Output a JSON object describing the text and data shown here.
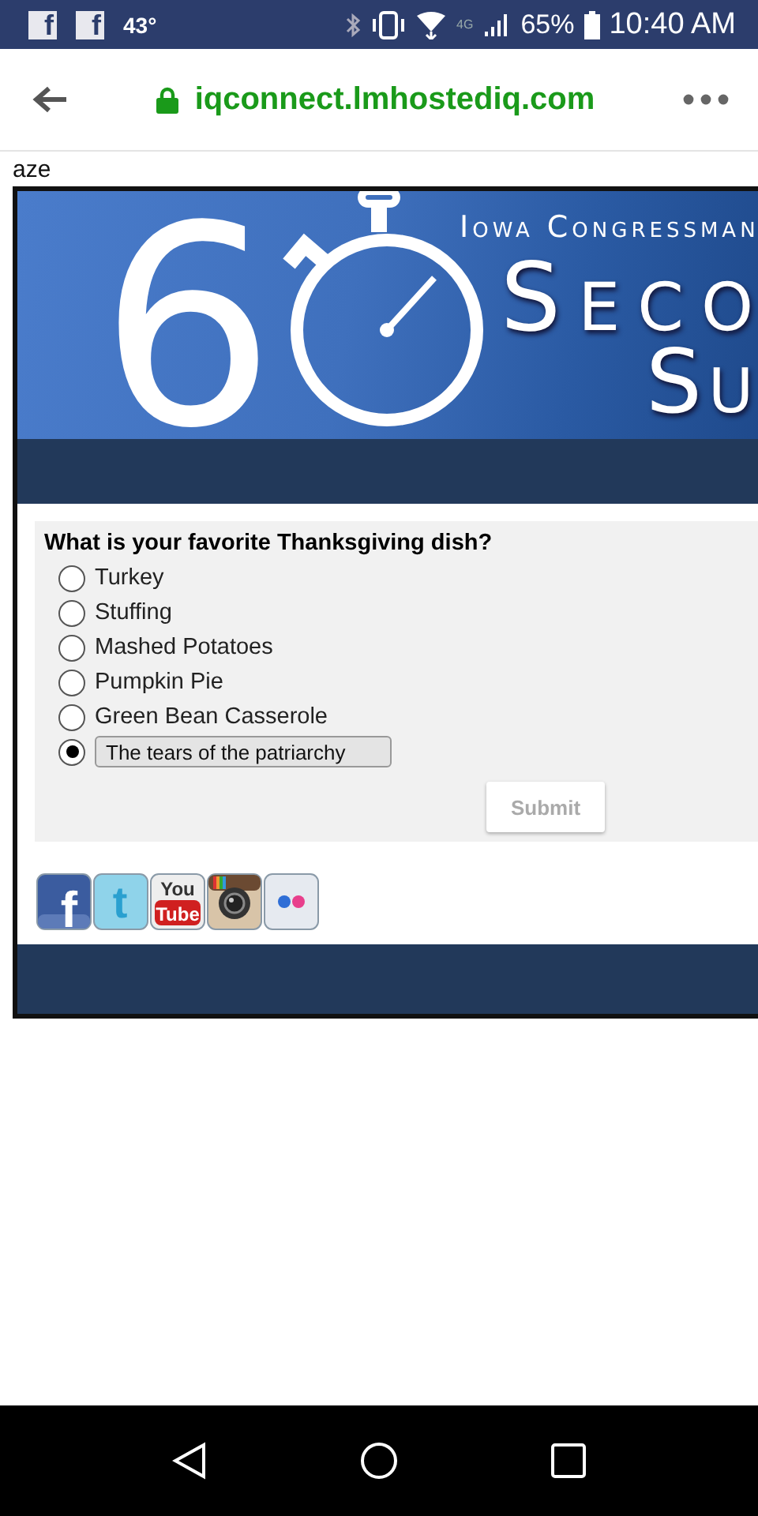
{
  "status_bar": {
    "notifications": [
      {
        "kind": "facebook",
        "glyph": "f"
      },
      {
        "kind": "facebook",
        "glyph": "f"
      }
    ],
    "temperature": "43°",
    "network": "4G",
    "battery": "65%",
    "time": "10:40 AM"
  },
  "browser_bar": {
    "url": "iqconnect.lmhostediq.com",
    "secure": true
  },
  "page_text": "aze",
  "banner": {
    "numeral": "6",
    "subtitle": "Iowa Congressman",
    "title_line_1": "Seco",
    "title_line_2": "Su"
  },
  "poll": {
    "question": "What is your favorite Thanksgiving dish?",
    "options": [
      {
        "kind": "choice",
        "label": "Turkey",
        "selected": false
      },
      {
        "kind": "choice",
        "label": "Stuffing",
        "selected": false
      },
      {
        "kind": "choice",
        "label": "Mashed Potatoes",
        "selected": false
      },
      {
        "kind": "choice",
        "label": "Pumpkin Pie",
        "selected": false
      },
      {
        "kind": "choice",
        "label": "Green Bean Casserole",
        "selected": false
      },
      {
        "kind": "other",
        "value": "The tears of the patriarchy",
        "selected": true
      }
    ],
    "submit": "Submit"
  },
  "social_icons": [
    {
      "kind": "facebook",
      "glyph": "f"
    },
    {
      "kind": "twitter",
      "glyph": "t"
    },
    {
      "kind": "youtube",
      "top": "You",
      "bottom": "Tube"
    },
    {
      "kind": "instagram"
    },
    {
      "kind": "flickr"
    }
  ]
}
